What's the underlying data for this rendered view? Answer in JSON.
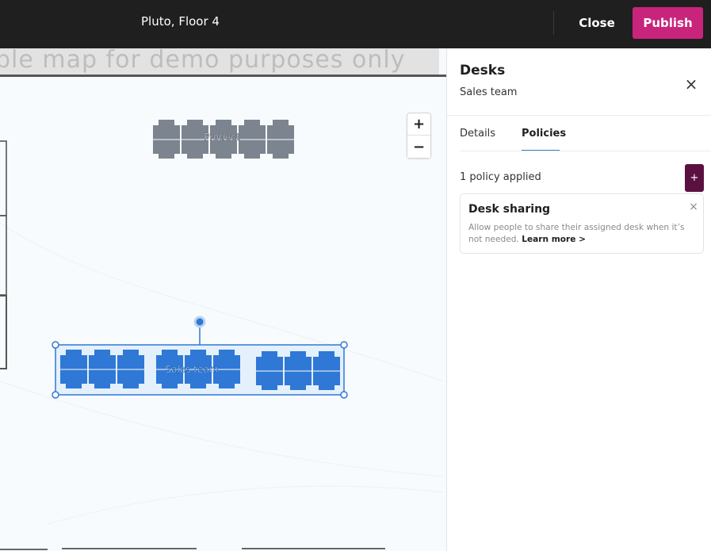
{
  "header": {
    "title": "Pluto, Floor 4",
    "close_label": "Close",
    "publish_label": "Publish",
    "publish_color": "#c9247c"
  },
  "map": {
    "watermark": "ple map for demo purposes only",
    "zoom_in_label": "+",
    "zoom_out_label": "−",
    "desk_groups": [
      {
        "label": "Product",
        "color": "#7c8490"
      },
      {
        "label": "Sales team",
        "color": "#2f78d6",
        "selected": true
      }
    ]
  },
  "panel": {
    "title": "Desks",
    "subtitle": "Sales team",
    "close_icon": "×",
    "tabs": [
      {
        "label": "Details",
        "active": false
      },
      {
        "label": "Policies",
        "active": true
      }
    ],
    "policies_applied": "1 policy applied",
    "add_policy_label": "+",
    "add_policy_color": "#5a1140",
    "policy": {
      "title": "Desk sharing",
      "remove_icon": "×",
      "description": "Allow people to share their assigned desk when it’s not needed.",
      "link": "Learn more >"
    }
  }
}
